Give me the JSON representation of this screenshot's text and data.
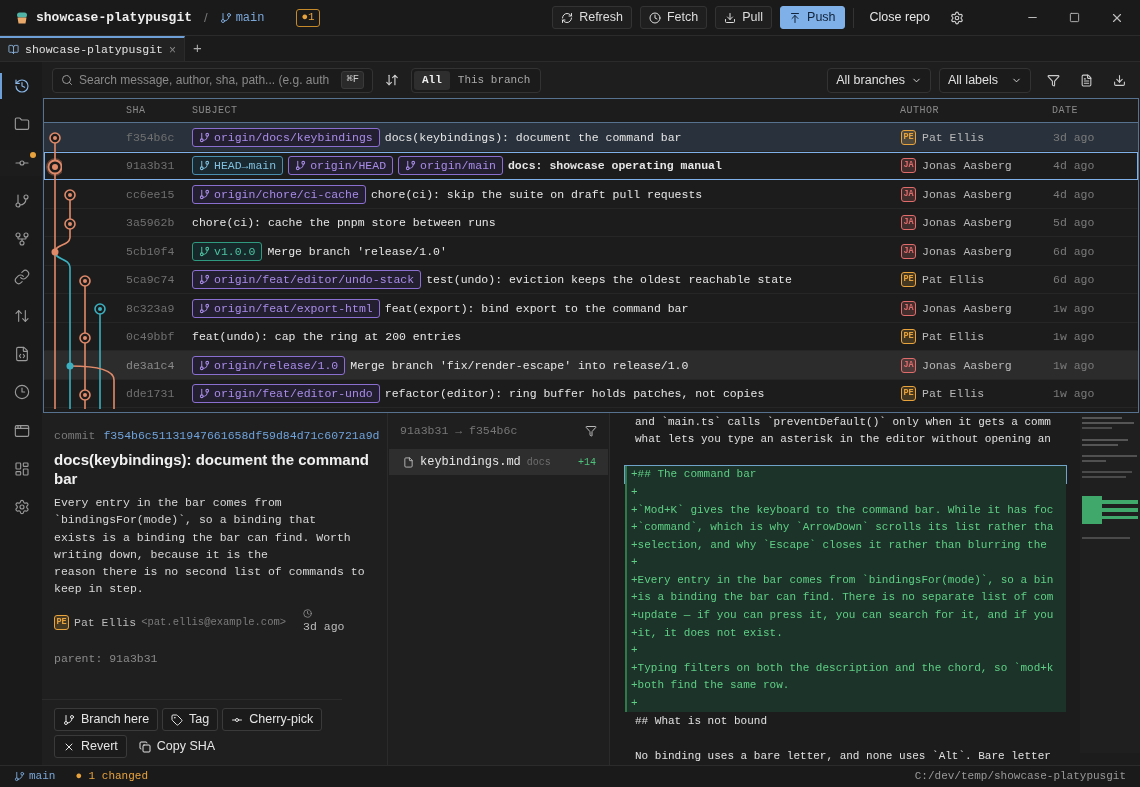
{
  "titlebar": {
    "repo": "showcase-platypusgit",
    "separator": "/",
    "branch": "main",
    "changes_badge": "●1",
    "actions": [
      {
        "label": "Refresh",
        "kind": "plain"
      },
      {
        "label": "Fetch",
        "kind": "plain"
      },
      {
        "label": "Pull",
        "kind": "plain"
      },
      {
        "label": "Push",
        "kind": "primary"
      }
    ],
    "close_repo": "Close repo"
  },
  "tabs": [
    {
      "label": "showcase-platypusgit",
      "selected": true,
      "close": "×"
    }
  ],
  "new_tab": "+",
  "sidebar": {
    "items": [
      {
        "selected": true,
        "has_changes": false
      },
      {
        "selected": false,
        "has_changes": false
      },
      {
        "selected": false,
        "has_changes": true
      },
      {
        "selected": false,
        "has_changes": false
      },
      {
        "selected": false,
        "has_changes": false
      },
      {
        "selected": false,
        "has_changes": false
      },
      {
        "selected": false,
        "has_changes": false
      },
      {
        "selected": false,
        "has_changes": false
      },
      {
        "selected": false,
        "has_changes": false
      },
      {
        "selected": false,
        "has_changes": false
      },
      {
        "selected": false,
        "has_changes": false
      },
      {
        "selected": false,
        "has_changes": false
      }
    ]
  },
  "toolbar": {
    "search": {
      "placeholder": "Search message, author, sha, path... (e.g. auth",
      "shortcut": "⌘F"
    },
    "scope": [
      {
        "label": "All",
        "selected": true
      },
      {
        "label": "This branch",
        "selected": false
      }
    ],
    "branch_filter": "All branches",
    "label_filter": "All labels"
  },
  "table": {
    "columns": [
      "SHA",
      "SUBJECT",
      "AUTHOR",
      "DATE"
    ],
    "rows": [
      {
        "sha": "f354b6c",
        "refs": [
          {
            "name": "origin/docs/keybindings",
            "kind": "remote"
          }
        ],
        "subject": "docs(keybindings): document the command bar",
        "author": "Pat Ellis",
        "initials": "PE",
        "color": "#e8a33d",
        "date": "3d ago",
        "selected": true,
        "focused": false,
        "head": false,
        "hovered": false
      },
      {
        "sha": "91a3b31",
        "refs": [
          {
            "name": "HEAD→main",
            "kind": "head"
          },
          {
            "name": "origin/HEAD",
            "kind": "remote"
          },
          {
            "name": "origin/main",
            "kind": "remote"
          }
        ],
        "subject": "docs: showcase operating manual",
        "author": "Jonas Aasberg",
        "initials": "JA",
        "color": "#e06c6c",
        "date": "4d ago",
        "selected": false,
        "focused": true,
        "head": true,
        "hovered": false
      },
      {
        "sha": "cc6ee15",
        "refs": [
          {
            "name": "origin/chore/ci-cache",
            "kind": "remote"
          }
        ],
        "subject": "chore(ci): skip the suite on draft pull requests",
        "author": "Jonas Aasberg",
        "initials": "JA",
        "color": "#e06c6c",
        "date": "4d ago",
        "selected": false,
        "focused": false,
        "head": false,
        "hovered": false
      },
      {
        "sha": "3a5962b",
        "refs": [],
        "subject": "chore(ci): cache the pnpm store between runs",
        "author": "Jonas Aasberg",
        "initials": "JA",
        "color": "#e06c6c",
        "date": "5d ago",
        "selected": false,
        "focused": false,
        "head": false,
        "hovered": false
      },
      {
        "sha": "5cb10f4",
        "refs": [
          {
            "name": "v1.0.0",
            "kind": "tag"
          }
        ],
        "subject": "Merge branch 'release/1.0'",
        "author": "Jonas Aasberg",
        "initials": "JA",
        "color": "#e06c6c",
        "date": "6d ago",
        "selected": false,
        "focused": false,
        "head": false,
        "hovered": false
      },
      {
        "sha": "5ca9c74",
        "refs": [
          {
            "name": "origin/feat/editor/undo-stack",
            "kind": "remote"
          }
        ],
        "subject": "test(undo): eviction keeps the oldest reachable state",
        "author": "Pat Ellis",
        "initials": "PE",
        "color": "#e8a33d",
        "date": "6d ago",
        "selected": false,
        "focused": false,
        "head": false,
        "hovered": false
      },
      {
        "sha": "8c323a9",
        "refs": [
          {
            "name": "origin/feat/export-html",
            "kind": "remote"
          }
        ],
        "subject": "feat(export): bind export to the command bar",
        "author": "Jonas Aasberg",
        "initials": "JA",
        "color": "#e06c6c",
        "date": "1w ago",
        "selected": false,
        "focused": false,
        "head": false,
        "hovered": false
      },
      {
        "sha": "0c49bbf",
        "refs": [],
        "subject": "feat(undo): cap the ring at 200 entries",
        "author": "Pat Ellis",
        "initials": "PE",
        "color": "#e8a33d",
        "date": "1w ago",
        "selected": false,
        "focused": false,
        "head": false,
        "hovered": false
      },
      {
        "sha": "de3a1c4",
        "refs": [
          {
            "name": "origin/release/1.0",
            "kind": "remote"
          }
        ],
        "subject": "Merge branch 'fix/render-escape' into release/1.0",
        "author": "Jonas Aasberg",
        "initials": "JA",
        "color": "#e06c6c",
        "date": "1w ago",
        "selected": false,
        "focused": false,
        "head": false,
        "hovered": true
      },
      {
        "sha": "dde1731",
        "refs": [
          {
            "name": "origin/feat/editor-undo",
            "kind": "remote"
          }
        ],
        "subject": "refactor(editor): ring buffer holds patches, not copies",
        "author": "Pat Ellis",
        "initials": "PE",
        "color": "#e8a33d",
        "date": "1w ago",
        "selected": false,
        "focused": false,
        "head": false,
        "hovered": false
      }
    ]
  },
  "details": {
    "label": "commit",
    "sha": "f354b6c51131947661658df59d84d71c60721a9d",
    "title": "docs(keybindings): document the command bar",
    "body": "Every entry in the bar comes from\n`bindingsFor(mode)`, so a binding that\nexists is a binding the bar can find. Worth\nwriting down, because it is the\nreason there is no second list of commands to\nkeep in step.",
    "author": "Pat Ellis",
    "initials": "PE",
    "color": "#e8a33d",
    "email": "<pat.ellis@example.com>",
    "date": "3d ago",
    "parent": "parent: 91a3b31",
    "actions": [
      {
        "label": "Branch here",
        "kind": "outlined"
      },
      {
        "label": "Tag",
        "kind": "outlined"
      },
      {
        "label": "Cherry-pick",
        "kind": "outlined"
      },
      {
        "label": "Revert",
        "kind": "outlined"
      },
      {
        "label": "Copy SHA",
        "kind": "plain"
      }
    ]
  },
  "files": {
    "range": "91a3b31 → f354b6c",
    "items": [
      {
        "name": "keybindings.md",
        "folder": "docs",
        "stat": "+14",
        "selected": true
      }
    ]
  },
  "diff": {
    "lines": [
      {
        "kind": "context",
        "text": "and `main.ts` calls `preventDefault()` only when it gets a comm"
      },
      {
        "kind": "context",
        "text": "what lets you type an asterisk in the editor without opening an"
      },
      {
        "kind": "blank"
      },
      {
        "kind": "added",
        "text": "+## The command bar",
        "focused": true
      },
      {
        "kind": "added",
        "text": "+",
        "focused": false
      },
      {
        "kind": "added",
        "text": "+`Mod+K` gives the keyboard to the command bar. While it has foc",
        "focused": false
      },
      {
        "kind": "added",
        "text": "+`command`, which is why `ArrowDown` scrolls its list rather tha",
        "focused": false
      },
      {
        "kind": "added",
        "text": "+selection, and why `Escape` closes it rather than blurring the",
        "focused": false
      },
      {
        "kind": "added",
        "text": "+",
        "focused": false
      },
      {
        "kind": "added",
        "text": "+Every entry in the bar comes from `bindingsFor(mode)`, so a bin",
        "focused": false
      },
      {
        "kind": "added",
        "text": "+is a binding the bar can find. There is no separate list of com",
        "focused": false
      },
      {
        "kind": "added",
        "text": "+update — if you can press it, you can search for it, and if you",
        "focused": false
      },
      {
        "kind": "added",
        "text": "+it, it does not exist.",
        "focused": false
      },
      {
        "kind": "added",
        "text": "+",
        "focused": false
      },
      {
        "kind": "added",
        "text": "+Typing filters on both the description and the chord, so `mod+k",
        "focused": false
      },
      {
        "kind": "added",
        "text": "+both find the same row.",
        "focused": false
      },
      {
        "kind": "added",
        "text": "+",
        "focused": false
      },
      {
        "kind": "context",
        "text": "## What is not bound"
      },
      {
        "kind": "blank"
      },
      {
        "kind": "context",
        "text": "No binding uses a bare letter, and none uses `Alt`. Bare letter"
      }
    ]
  },
  "status_bar": {
    "branch": "main",
    "changes": "● 1 changed",
    "path": "C:/dev/temp/showcase-platypusgit"
  }
}
